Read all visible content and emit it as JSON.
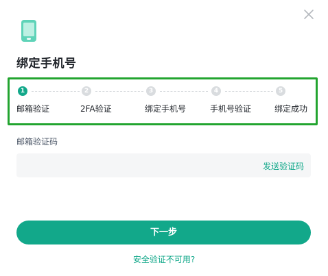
{
  "dialog": {
    "title": "绑定手机号",
    "close_icon": "close-icon",
    "header_icon": "mobile-phone-icon",
    "accent_color": "#12a88a",
    "highlight_border_color": "#22a42f"
  },
  "steps": [
    {
      "number": "1",
      "label": "邮箱验证",
      "active": true
    },
    {
      "number": "2",
      "label": "2FA验证",
      "active": false
    },
    {
      "number": "3",
      "label": "绑定手机号",
      "active": false
    },
    {
      "number": "4",
      "label": "手机号验证",
      "active": false
    },
    {
      "number": "5",
      "label": "绑定成功",
      "active": false
    }
  ],
  "form": {
    "email_code_label": "邮箱验证码",
    "email_code_value": "",
    "email_code_placeholder": "",
    "send_code_label": "发送验证码"
  },
  "actions": {
    "next_label": "下一步",
    "unavailable_link": "安全验证不可用?"
  }
}
